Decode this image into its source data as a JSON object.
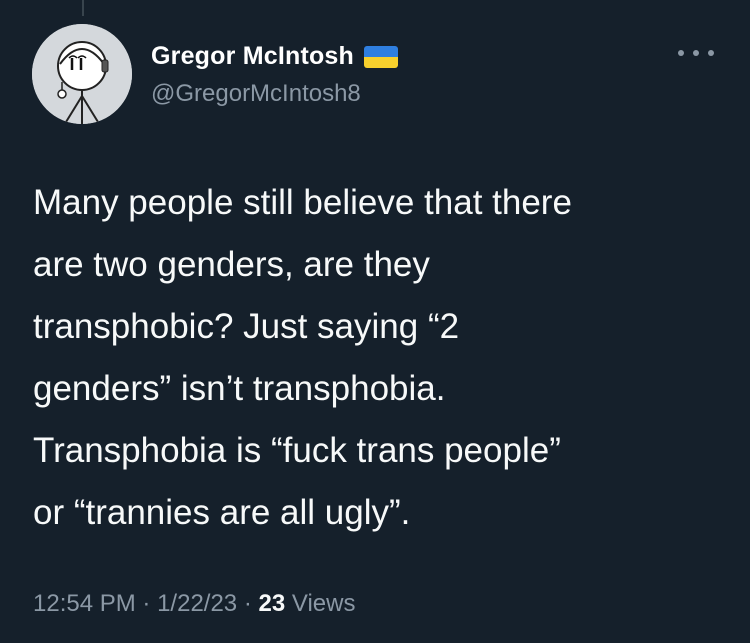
{
  "tweet": {
    "author": {
      "display_name": "Gregor McIntosh",
      "handle": "@GregorMcIntosh8",
      "avatar": "cartoon-stick-figure-avatar",
      "flag": "ukraine-flag-icon"
    },
    "more_icon": "more-dots-icon",
    "text_lines": [
      "Many people still believe that there",
      "are two genders, are they",
      "transphobic? Just saying “2",
      "genders” isn’t transphobia.",
      "Transphobia is “fuck trans people”",
      "or “trannies are all ugly”."
    ],
    "time": "12:54 PM",
    "separator": "·",
    "date": "1/22/23",
    "views_count": "23",
    "views_label": "Views"
  },
  "colors": {
    "background": "#15202b",
    "primary_text": "#f7f9f9",
    "secondary_text": "#8b98a5",
    "flag_blue": "#2f7fe0",
    "flag_yellow": "#f7d02d"
  }
}
